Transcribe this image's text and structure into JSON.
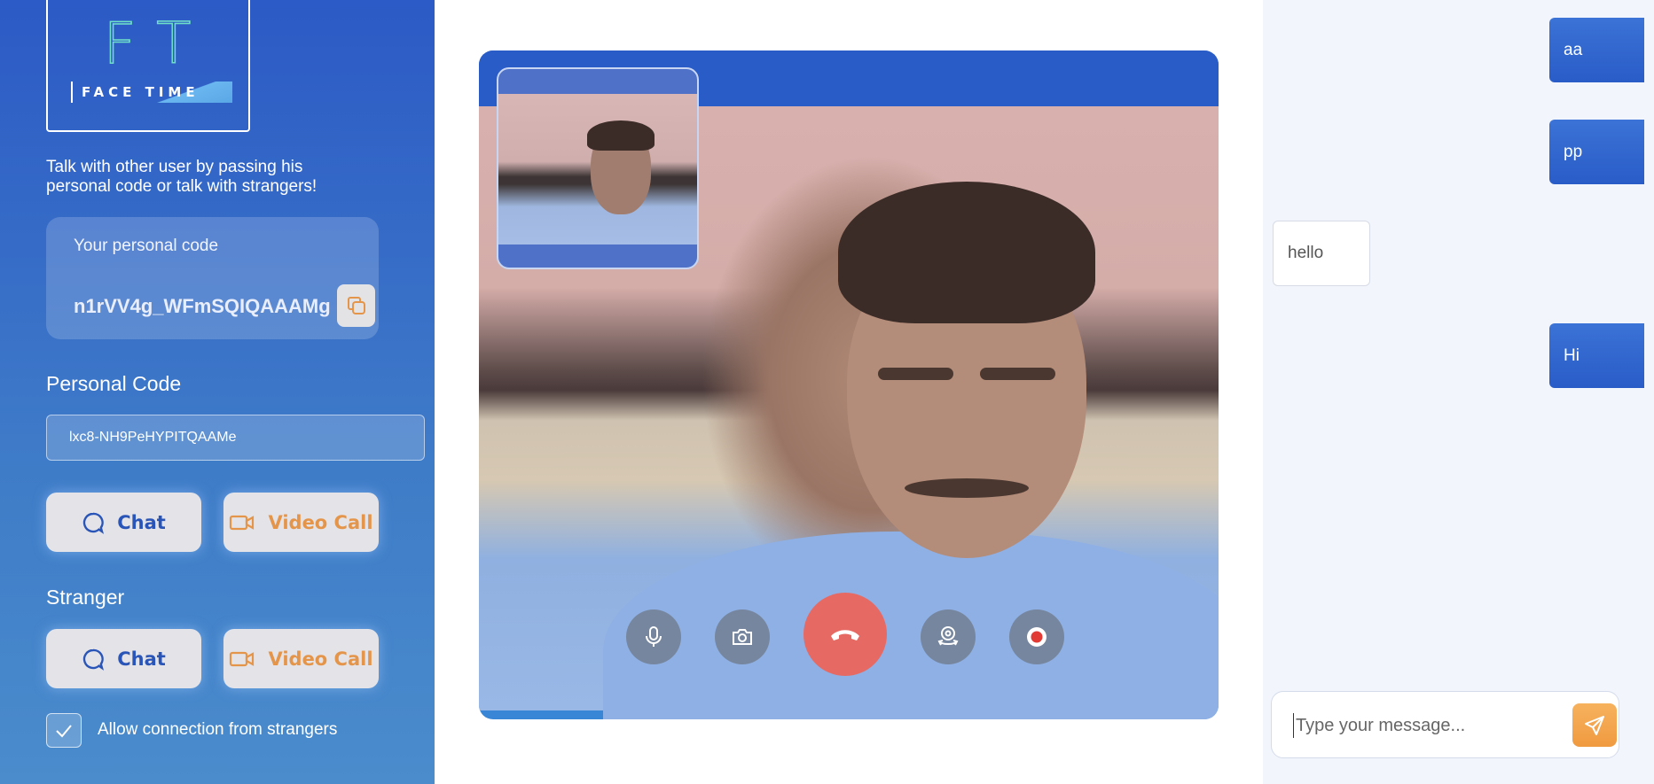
{
  "logo": {
    "letters": "FT",
    "subtitle": "FACE TIME"
  },
  "sidebar": {
    "intro": "Talk with other user by passing his personal code or talk with strangers!",
    "code_card": {
      "title": "Your personal code",
      "value": "n1rVV4g_WFmSQIQAAAMg",
      "copy_icon": "copy-icon"
    },
    "personal_code_label": "Personal Code",
    "personal_code_input": {
      "value": "lxc8-NH9PeHYPITQAAMe",
      "placeholder": ""
    },
    "personal_buttons": {
      "chat": "Chat",
      "video": "Video Call"
    },
    "stranger_label": "Stranger",
    "stranger_buttons": {
      "chat": "Chat",
      "video": "Video Call"
    },
    "allow_strangers": {
      "label": "Allow connection from strangers",
      "checked": true
    }
  },
  "video": {
    "controls": [
      "mic-icon",
      "camera-icon",
      "hang-up-icon",
      "switch-camera-icon",
      "record-icon"
    ]
  },
  "chat": {
    "messages": [
      {
        "text": "aa",
        "direction": "outgoing"
      },
      {
        "text": "pp",
        "direction": "outgoing"
      },
      {
        "text": "hello",
        "direction": "incoming"
      },
      {
        "text": "Hi",
        "direction": "outgoing"
      }
    ],
    "composer": {
      "placeholder": "Type your message...",
      "value": "",
      "send_icon": "send-icon"
    }
  },
  "colors": {
    "sidebar_top": "#2c5ac6",
    "sidebar_bottom": "#4a8ccc",
    "video_frame": "#3a86d6",
    "hang_up": "#e66a63",
    "accent_orange": "#f09a40",
    "chat_bg": "#f2f6fc"
  }
}
